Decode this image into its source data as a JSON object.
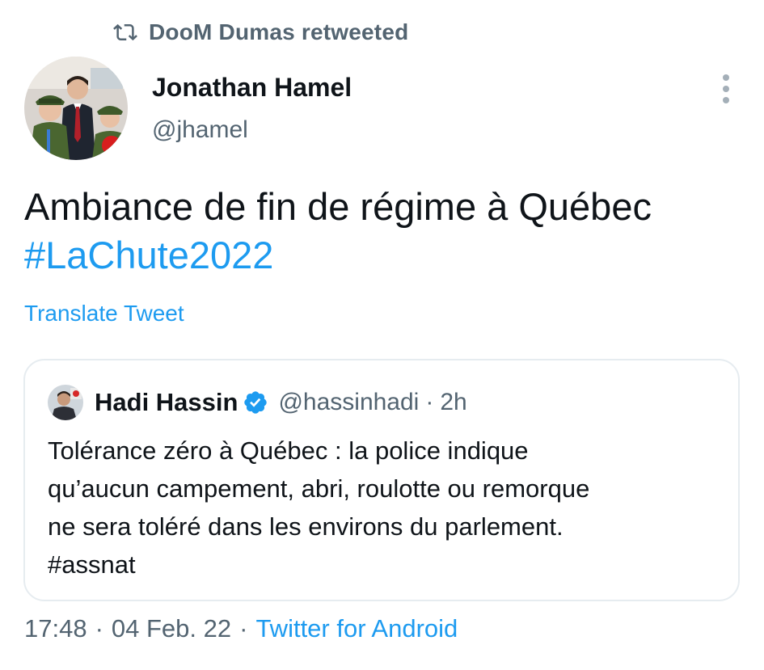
{
  "retweet": {
    "label": "DooM Dumas retweeted",
    "icon": "retweet-icon"
  },
  "author": {
    "name": "Jonathan Hamel",
    "handle": "@jhamel",
    "avatar_icon": "profile-photo"
  },
  "more_icon": "more-options-icon",
  "tweet": {
    "text": "Ambiance de fin de régime à Québec",
    "hashtag": "#LaChute2022",
    "translate_label": "Translate Tweet"
  },
  "quote": {
    "name": "Hadi Hassin",
    "verified_icon": "verified-badge-icon",
    "handle": "@hassinhadi",
    "separator": "·",
    "time": "2h",
    "lines": [
      "Tolérance zéro à Québec : la police indique",
      "qu’aucun campement, abri, roulotte ou remorque",
      "ne sera toléré dans les environs du parlement.",
      "#assnat"
    ]
  },
  "meta": {
    "time": "17:48",
    "separator": "·",
    "date": "04 Feb. 22",
    "source": "Twitter for Android"
  },
  "colors": {
    "link": "#1d9bf0",
    "secondary_text": "#536471",
    "primary_text": "#0f1419",
    "border": "#e6ecf0"
  }
}
